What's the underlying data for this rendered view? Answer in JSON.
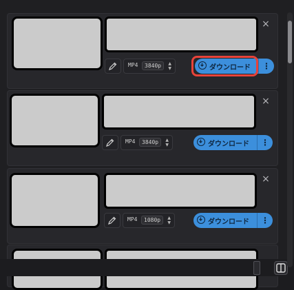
{
  "items": [
    {
      "format": "MP4",
      "resolution": "3840p",
      "download_label": "ダウンロード"
    },
    {
      "format": "MP4",
      "resolution": "3840p",
      "download_label": "ダウンロード"
    },
    {
      "format": "MP4",
      "resolution": "1080p",
      "download_label": "ダウンロード"
    }
  ],
  "close_glyph": "×",
  "more_glyph": "⋮",
  "colors": {
    "accent": "#3c8fdc",
    "highlight": "#e8433a",
    "background": "#1f1f22"
  }
}
